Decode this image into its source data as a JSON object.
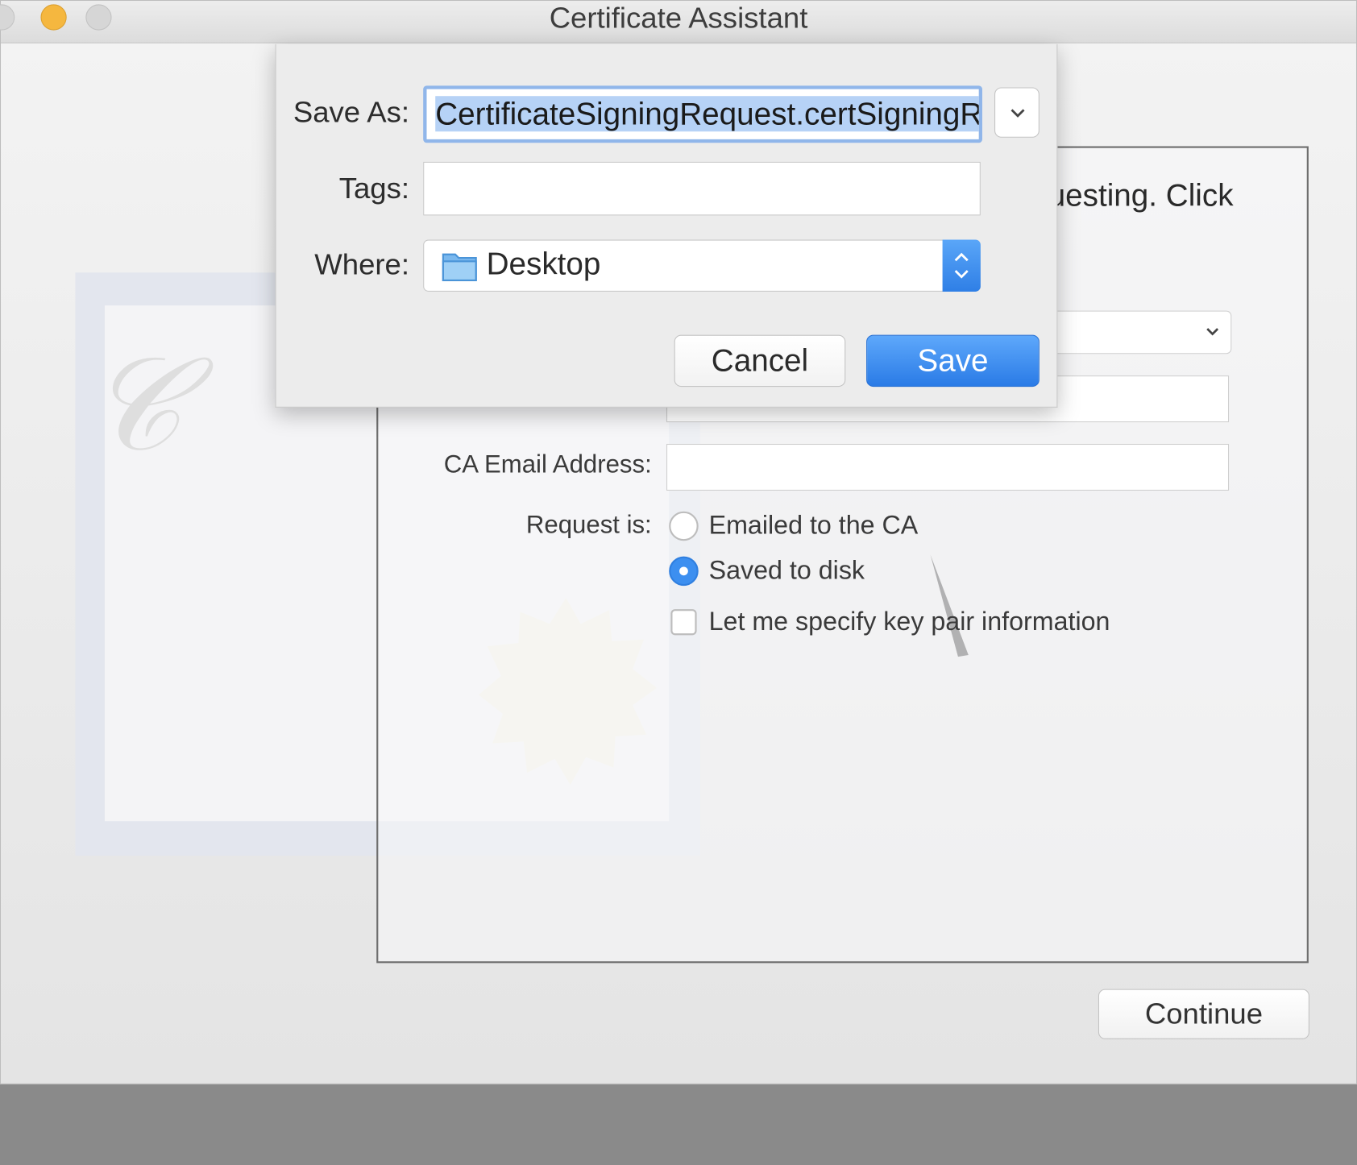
{
  "window": {
    "title": "Certificate Assistant"
  },
  "background": {
    "intro_fragment": "uesting. Click",
    "ca_email_label": "CA Email Address:",
    "ca_email_value": "",
    "request_is_label": "Request is:",
    "options": [
      {
        "label": "Emailed to the CA",
        "selected": false
      },
      {
        "label": "Saved to disk",
        "selected": true
      }
    ],
    "key_pair_checkbox": {
      "label": "Let me specify key pair information",
      "checked": false
    },
    "continue_label": "Continue"
  },
  "save_sheet": {
    "save_as_label": "Save As:",
    "save_as_value": "CertificateSigningRequest.certSigningRe",
    "tags_label": "Tags:",
    "tags_value": "",
    "where_label": "Where:",
    "where_value": "Desktop",
    "cancel_label": "Cancel",
    "save_label": "Save"
  },
  "colors": {
    "accent": "#2f7fe6",
    "minimize": "#f5b73f"
  }
}
